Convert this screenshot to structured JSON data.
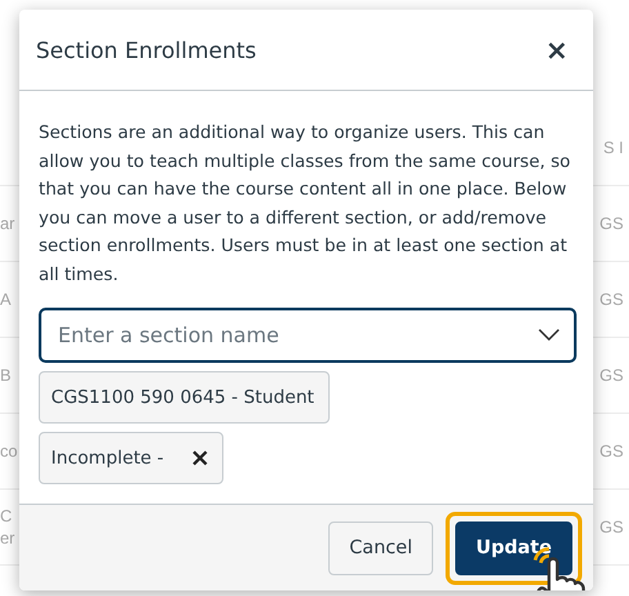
{
  "background_table": {
    "header": "S I",
    "rows": [
      {
        "column_1": [
          "ar"
        ],
        "column_2": "GS"
      },
      {
        "column_1": [
          "A"
        ],
        "column_2": "GS"
      },
      {
        "column_1": [
          "B"
        ],
        "column_2": "GS"
      },
      {
        "column_1": [
          "co"
        ],
        "column_2": "GS"
      },
      {
        "column_1": [
          "C",
          "er"
        ],
        "column_2": "GS"
      }
    ]
  },
  "dialog": {
    "title": "Section Enrollments",
    "close": "×",
    "description": "Sections are an additional way to organize users. This can allow you to teach multiple classes from the same course, so that you can have the course content all in one place. Below you can move a user to a different section, or add/remove section enrollments. Users must be in at least one section at all times.",
    "section_field": {
      "placeholder": "Enter a section name"
    },
    "enrollments": [
      {
        "label": "CGS1100 590 0645 - Student",
        "removable": false
      },
      {
        "label": "Incomplete -",
        "removable": true
      }
    ],
    "buttons": [
      {
        "label": "Cancel",
        "kind": "secondary",
        "highlighted": false
      },
      {
        "label": "Update",
        "kind": "primary",
        "highlighted": true
      }
    ]
  }
}
